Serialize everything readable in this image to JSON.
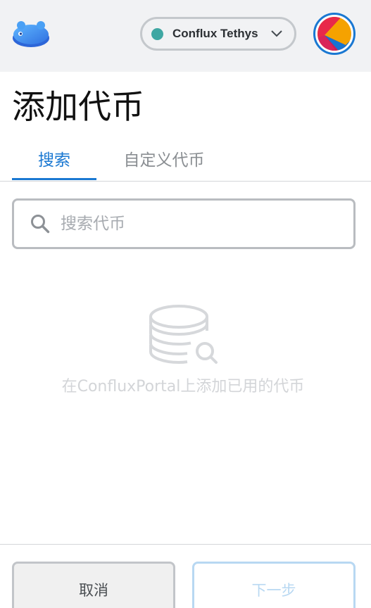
{
  "header": {
    "network": {
      "label": "Conflux Tethys",
      "status_color": "#3fa7a3"
    },
    "icons": {
      "logo": "conflux-portal-logo",
      "chevron": "chevron-down-icon",
      "avatar": "account-avatar-identicon"
    }
  },
  "page": {
    "title": "添加代币"
  },
  "tabs": [
    {
      "label": "搜索",
      "active": true
    },
    {
      "label": "自定义代币",
      "active": false
    }
  ],
  "search": {
    "placeholder": "搜索代币",
    "value": "",
    "icon": "search-icon"
  },
  "empty_state": {
    "icon": "coins-search-icon",
    "text": "在ConfluxPortal上添加已用的代币"
  },
  "footer": {
    "cancel_label": "取消",
    "next_label": "下一步"
  },
  "colors": {
    "accent": "#1a78d2",
    "header_bg": "#f1f2f4",
    "disabled_primary": "#b8d8f2"
  }
}
